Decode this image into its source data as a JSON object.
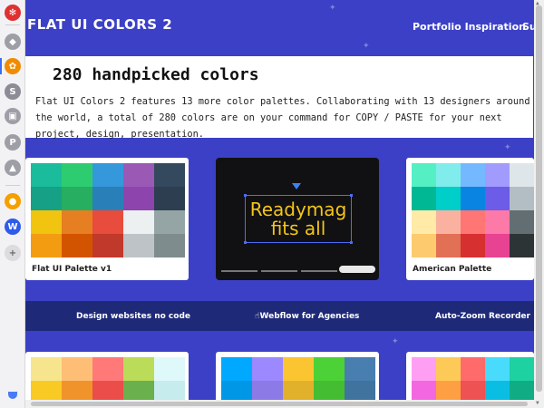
{
  "sidebar": {
    "items": [
      {
        "name": "ext-new",
        "color": "#e03131",
        "glyph": "✻"
      },
      {
        "name": "ext-shield",
        "color": "#9e9ea6",
        "glyph": "◆"
      },
      {
        "name": "ext-photos",
        "color": "#f08c00",
        "glyph": "✿"
      },
      {
        "name": "ext-s",
        "color": "#8c8c96",
        "glyph": "S"
      },
      {
        "name": "ext-chat",
        "color": "#9e9ea6",
        "glyph": "▣"
      },
      {
        "name": "ext-ps",
        "color": "#9e9ea6",
        "glyph": "P"
      },
      {
        "name": "ext-mountain",
        "color": "#9e9ea6",
        "glyph": "▲"
      },
      {
        "name": "ext-coin",
        "color": "#f59f00",
        "glyph": "●"
      },
      {
        "name": "ext-webflow",
        "color": "#2f5bea",
        "glyph": "W"
      },
      {
        "name": "ext-add",
        "color": "#dcdce0",
        "glyph": "+"
      }
    ]
  },
  "nav": {
    "brand": "FLAT UI COLORS 2",
    "link1": "Portfolio Inspiration",
    "link2": "Su"
  },
  "intro": {
    "title": "280 handpicked colors",
    "text": "Flat UI Colors 2 features 13 more color palettes. Collaborating with 13 designers around the world, a total of 280 colors are on your command for COPY / PASTE for your next project, design, presentation."
  },
  "cards": [
    {
      "name": "Flat UI Palette v1",
      "swatches": [
        "#1abc9c",
        "#2ecc71",
        "#3498db",
        "#9b59b6",
        "#34495e",
        "#16a085",
        "#27ae60",
        "#2980b9",
        "#8e44ad",
        "#2c3e50",
        "#f1c40f",
        "#e67e22",
        "#e74c3c",
        "#ecf0f1",
        "#95a5a6",
        "#f39c12",
        "#d35400",
        "#c0392b",
        "#bdc3c7",
        "#7f8c8d"
      ]
    },
    {
      "name": "American Palette",
      "swatches": [
        "#55efc4",
        "#81ecec",
        "#74b9ff",
        "#a29bfe",
        "#dfe6e9",
        "#00b894",
        "#00cec9",
        "#0984e3",
        "#6c5ce7",
        "#b2bec3",
        "#ffeaa7",
        "#fab1a0",
        "#ff7675",
        "#fd79a8",
        "#636e72",
        "#fdcb6e",
        "#e17055",
        "#d63031",
        "#e84393",
        "#2d3436"
      ]
    },
    {
      "name": "",
      "swatches": [
        "#f6e58d",
        "#ffbe76",
        "#ff7979",
        "#badc58",
        "#dff9fb",
        "#f9ca24",
        "#f0932b",
        "#eb4d4b",
        "#6ab04c",
        "#c7ecee"
      ]
    },
    {
      "name": "",
      "swatches": [
        "#00a8ff",
        "#9c88ff",
        "#fbc531",
        "#4cd137",
        "#487eb0",
        "#0097e6",
        "#8c7ae6",
        "#e1b12c",
        "#44bd32",
        "#40739e"
      ]
    },
    {
      "name": "",
      "swatches": [
        "#ff9ff3",
        "#feca57",
        "#ff6b6b",
        "#48dbfb",
        "#1dd1a1",
        "#f368e0",
        "#ff9f43",
        "#ee5253",
        "#0abde3",
        "#10ac84"
      ]
    }
  ],
  "ad": {
    "line1": "Readymag",
    "line2": "fits all"
  },
  "banner": {
    "item1": "Design websites no code",
    "item2": "☝Webflow for Agencies",
    "item3": "Auto-Zoom Recorder"
  }
}
